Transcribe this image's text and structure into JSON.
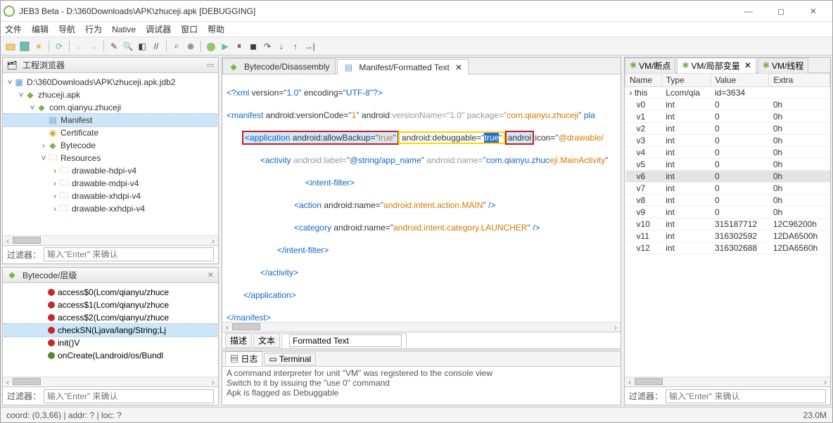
{
  "window": {
    "title": "JEB3 Beta - D:\\360Downloads\\APK\\zhuceji.apk [DEBUGGING]"
  },
  "menu": [
    "文件",
    "编辑",
    "导航",
    "行为",
    "Native",
    "调试器",
    "窗口",
    "帮助"
  ],
  "panes": {
    "project_explorer": "工程浏览器",
    "bytecode_hierarchy": "Bytecode/层级"
  },
  "tree": {
    "root": "D:\\360Downloads\\APK\\zhuceji.apk.jdb2",
    "apk": "zhuceji.apk",
    "pkg": "com.qianyu.zhuceji",
    "manifest": "Manifest",
    "certificate": "Certificate",
    "bytecode": "Bytecode",
    "resources": "Resources",
    "res_items": [
      "drawable-hdpi-v4",
      "drawable-mdpi-v4",
      "drawable-xhdpi-v4",
      "drawable-xxhdpi-v4"
    ]
  },
  "filter": {
    "label": "过滤器：",
    "placeholder": "输入\"Enter\" 来确认"
  },
  "outline": {
    "items": [
      {
        "label": "access$0(Lcom/qianyu/zhuce",
        "kind": "red"
      },
      {
        "label": "access$1(Lcom/qianyu/zhuce",
        "kind": "red"
      },
      {
        "label": "access$2(Lcom/qianyu/zhuce",
        "kind": "red"
      },
      {
        "label": "checkSN(Ljava/lang/String;Lj",
        "kind": "red",
        "sel": true
      },
      {
        "label": "init()V",
        "kind": "red"
      },
      {
        "label": "onCreate(Landroid/os/Bundl",
        "kind": "green"
      }
    ]
  },
  "editor_tabs": {
    "bytecode": "Bytecode/Disassembly",
    "manifest": "Manifest/Formatted Text"
  },
  "code": {
    "l1": "<?xml version=\"1.0\" encoding=\"UTF-8\"?>",
    "l2_a": "<manifest android:versionCode=\"",
    "l2_b": "1",
    "l2_c": "\" android",
    "l2_pkg": "com.qianyu.zhuceji",
    "l2_d": "\" pla",
    "l3_a": "    <application android:allowBackup=\"",
    "l3_true": "true",
    "l3_b": " android:debuggable=\"",
    "l3_true2": "true",
    "l3_c": " androi",
    "l3_icon": "@drawable/",
    "l4": "        <activity android:label=\"",
    "l4_act": "eji.MainActivity",
    "l5": "            <intent-filter>",
    "l6a": "                <action android:name=\"",
    "l6v": "android.intent.action.MAIN",
    "l6b": "\" />",
    "l7a": "                <category android:name=\"",
    "l7v": "android.intent.category.LAUNCHER",
    "l7b": "\" />",
    "l8": "            </intent-filter>",
    "l9": "        </activity>",
    "l10": "    </application>",
    "l11": "</manifest>"
  },
  "bottom_tabs": {
    "desc": "描述",
    "text": "文本",
    "formatted": "Formatted Text"
  },
  "log_tabs": {
    "log": "日志",
    "terminal": "Terminal"
  },
  "log_lines": [
    "A command interpreter for unit \"VM\" was registered to the console view",
    "Switch to it by issuing the \"use 0\" command",
    "Apk is flagged as Debuggable"
  ],
  "vm_tabs": {
    "bp": "VM/断点",
    "locals": "VM/局部变量",
    "threads": "VM/线程"
  },
  "vartable": {
    "headers": [
      "Name",
      "Type",
      "Value",
      "Extra"
    ],
    "rows": [
      {
        "n": "this",
        "t": "Lcom/qia",
        "v": "id=3634",
        "e": "",
        "exp": true
      },
      {
        "n": "v0",
        "t": "int",
        "v": "0",
        "e": "0h"
      },
      {
        "n": "v1",
        "t": "int",
        "v": "0",
        "e": "0h"
      },
      {
        "n": "v2",
        "t": "int",
        "v": "0",
        "e": "0h"
      },
      {
        "n": "v3",
        "t": "int",
        "v": "0",
        "e": "0h"
      },
      {
        "n": "v4",
        "t": "int",
        "v": "0",
        "e": "0h"
      },
      {
        "n": "v5",
        "t": "int",
        "v": "0",
        "e": "0h"
      },
      {
        "n": "v6",
        "t": "int",
        "v": "0",
        "e": "0h",
        "sel": true
      },
      {
        "n": "v7",
        "t": "int",
        "v": "0",
        "e": "0h"
      },
      {
        "n": "v8",
        "t": "int",
        "v": "0",
        "e": "0h"
      },
      {
        "n": "v9",
        "t": "int",
        "v": "0",
        "e": "0h"
      },
      {
        "n": "v10",
        "t": "int",
        "v": "315187712",
        "e": "12C96200h"
      },
      {
        "n": "v11",
        "t": "int",
        "v": "316302592",
        "e": "12DA6500h"
      },
      {
        "n": "v12",
        "t": "int",
        "v": "316302688",
        "e": "12DA6560h"
      }
    ]
  },
  "status": {
    "left": "coord: (0,3,66) | addr: ? | loc: ?",
    "right": "23.0M"
  }
}
